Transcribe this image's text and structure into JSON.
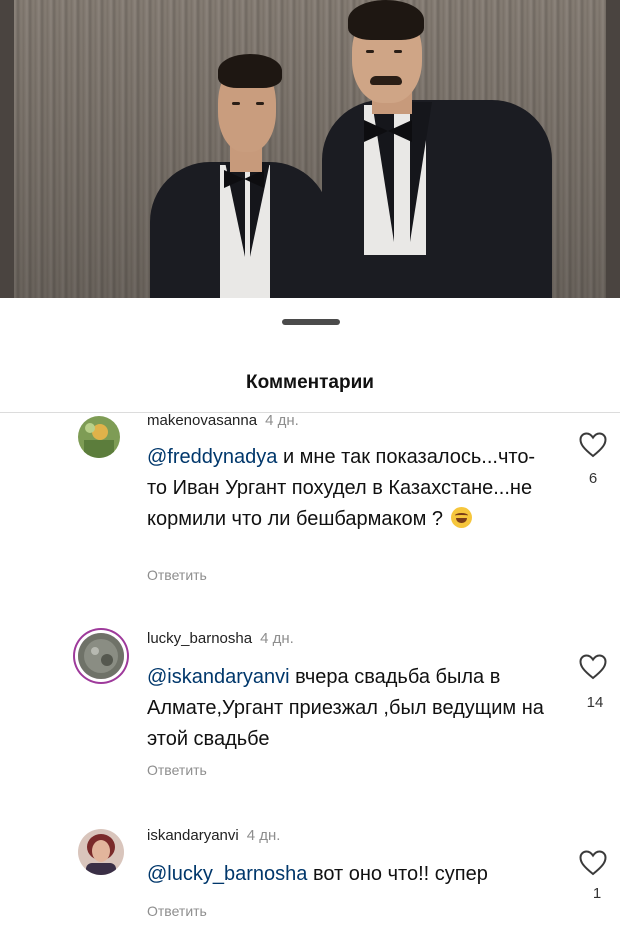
{
  "sheet": {
    "title": "Комментарии"
  },
  "comments": [
    {
      "username": "makenovasanna",
      "time": "4 дн.",
      "mention": "@freddynadya",
      "text": " и мне так показалось...что-то Иван Ургант похудел в Казахстане...не кормили что ли бешбармаком ? ",
      "emoji": "laughing-face-emoji",
      "reply": "Ответить",
      "likes": "6"
    },
    {
      "username": "lucky_barnosha",
      "time": "4 дн.",
      "mention": "@iskandaryanvi",
      "text": " вчера свадьба была в Алмате,Ургант приезжал ,был ведущим на этой свадьбе",
      "reply": "Ответить",
      "likes": "14"
    },
    {
      "username": "iskandaryanvi",
      "time": "4 дн.",
      "mention": "@lucky_barnosha",
      "text": " вот оно что!! супер",
      "reply": "Ответить",
      "likes": "1"
    }
  ],
  "colors": {
    "mention": "#00376b",
    "secondary_text": "#8e8e8e",
    "story_ring": "#9e3a9b"
  },
  "icons": {
    "like": "heart-outline-icon",
    "sheet_handle": "drag-handle"
  }
}
